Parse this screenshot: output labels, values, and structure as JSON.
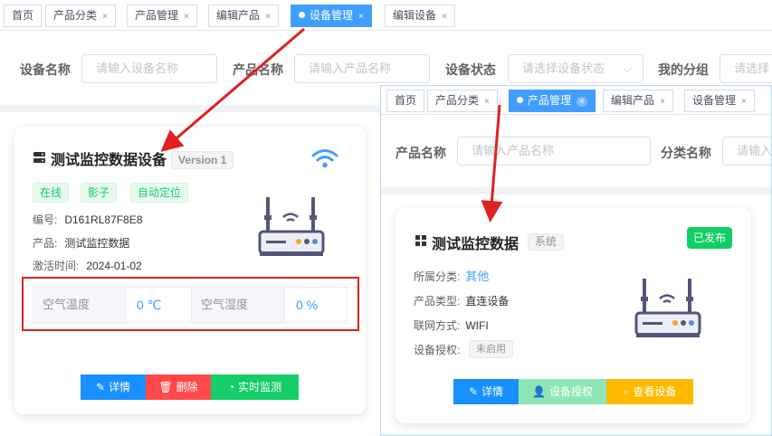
{
  "left": {
    "tabs": [
      {
        "label": "首页",
        "close": ""
      },
      {
        "label": "产品分类",
        "close": "×"
      },
      {
        "label": "产品管理",
        "close": "×"
      },
      {
        "label": "编辑产品",
        "close": "×"
      },
      {
        "label": "设备管理",
        "close": "×"
      },
      {
        "label": "编辑设备",
        "close": "×"
      }
    ],
    "filters": {
      "device_name_label": "设备名称",
      "device_name_placeholder": "请输入设备名称",
      "product_name_label": "产品名称",
      "product_name_placeholder": "请输入产品名称",
      "device_status_label": "设备状态",
      "device_status_placeholder": "请选择设备状态",
      "my_group_label": "我的分组",
      "my_group_placeholder": "请选择"
    },
    "card": {
      "title": "测试监控数据设备",
      "version": "Version 1",
      "tags": [
        "在线",
        "影子",
        "自动定位"
      ],
      "serial_label": "编号:",
      "serial": "D161RL87F8E8",
      "product_label": "产品:",
      "product": "测试监控数据",
      "activated_label": "激活时间:",
      "activated": "2024-01-02",
      "metrics": [
        {
          "name": "空气温度",
          "value": "0 ℃"
        },
        {
          "name": "空气湿度",
          "value": "0 %"
        }
      ],
      "buttons": {
        "detail": "详情",
        "delete": "删除",
        "monitor": "实时监测"
      }
    }
  },
  "right": {
    "tabs": [
      {
        "label": "首页",
        "close": ""
      },
      {
        "label": "产品分类",
        "close": "×"
      },
      {
        "label": "产品管理",
        "close": "×"
      },
      {
        "label": "编辑产品",
        "close": "×"
      },
      {
        "label": "设备管理",
        "close": "×"
      }
    ],
    "filters": {
      "product_name_label": "产品名称",
      "product_name_placeholder": "请输入产品名称",
      "category_label": "分类名称",
      "category_placeholder": "请输入"
    },
    "card": {
      "title": "测试监控数据",
      "badge": "系统",
      "status": "已发布",
      "category_label": "所属分类:",
      "category": "其他",
      "type_label": "产品类型:",
      "type": "直连设备",
      "network_label": "联网方式:",
      "network": "WIFI",
      "auth_label": "设备授权:",
      "auth": "未启用",
      "buttons": {
        "detail": "详情",
        "auth": "设备授权",
        "view": "查看设备"
      }
    }
  },
  "colors": {
    "primary": "#409eff",
    "danger": "#ff4949",
    "success": "#13ce66",
    "warning": "#ffba00",
    "arrow": "#e02020"
  }
}
